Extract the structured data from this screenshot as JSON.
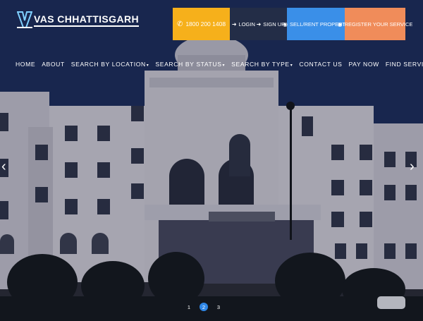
{
  "brand": {
    "name": "VAS CHHATTISGARH"
  },
  "topbar": {
    "phone": "1800 200 1408",
    "login_label": "LOGIN",
    "signup_label": "SIGN UP",
    "sell_label": "SELL/RENT PROPERTY",
    "service_label": "REGISTER YOUR SERVICE"
  },
  "nav": {
    "items": [
      {
        "label": "HOME"
      },
      {
        "label": "ABOUT"
      },
      {
        "label": "SEARCH BY LOCATION",
        "dropdown": true
      },
      {
        "label": "SEARCH BY STATUS",
        "dropdown": true
      },
      {
        "label": "SEARCH BY TYPE",
        "dropdown": true
      },
      {
        "label": "CONTACT US"
      },
      {
        "label": "PAY NOW"
      },
      {
        "label": "FIND SERVICES"
      }
    ]
  },
  "slider": {
    "prev_icon": "‹",
    "next_icon": "›",
    "pages": [
      "1",
      "2",
      "3"
    ],
    "active_page": "2"
  },
  "colors": {
    "phone_bg": "#f6b01b",
    "auth_bg": "#232d47",
    "sell_bg": "#3a8fe8",
    "service_bg": "#f08c5a",
    "active_dot": "#2e86e6"
  },
  "icons": {
    "phone": "phone-icon",
    "login": "login-icon",
    "signup": "signup-icon",
    "sell": "pin-icon",
    "service": "pin-icon"
  }
}
